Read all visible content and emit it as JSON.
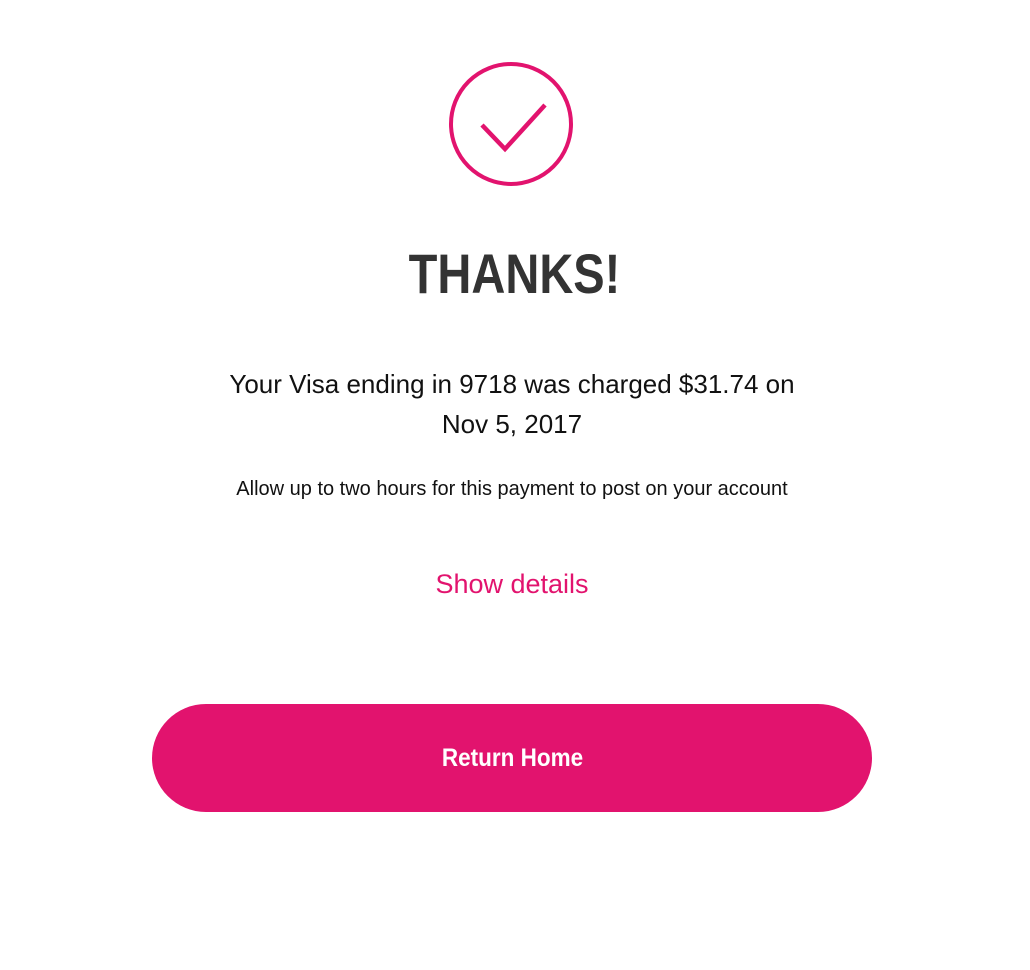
{
  "colors": {
    "brand": "#e2136e",
    "title": "#333333",
    "text": "#111111",
    "background": "#ffffff"
  },
  "confirmation": {
    "icon": "check-circle-icon",
    "title": "THANKS!",
    "message_line1": "Your Visa ending in 9718 was charged $31.74 on",
    "message_line2": "Nov 5, 2017",
    "note": "Allow up to two hours for this payment to post on your account",
    "details_link": "Show details",
    "return_button": "Return Home"
  }
}
